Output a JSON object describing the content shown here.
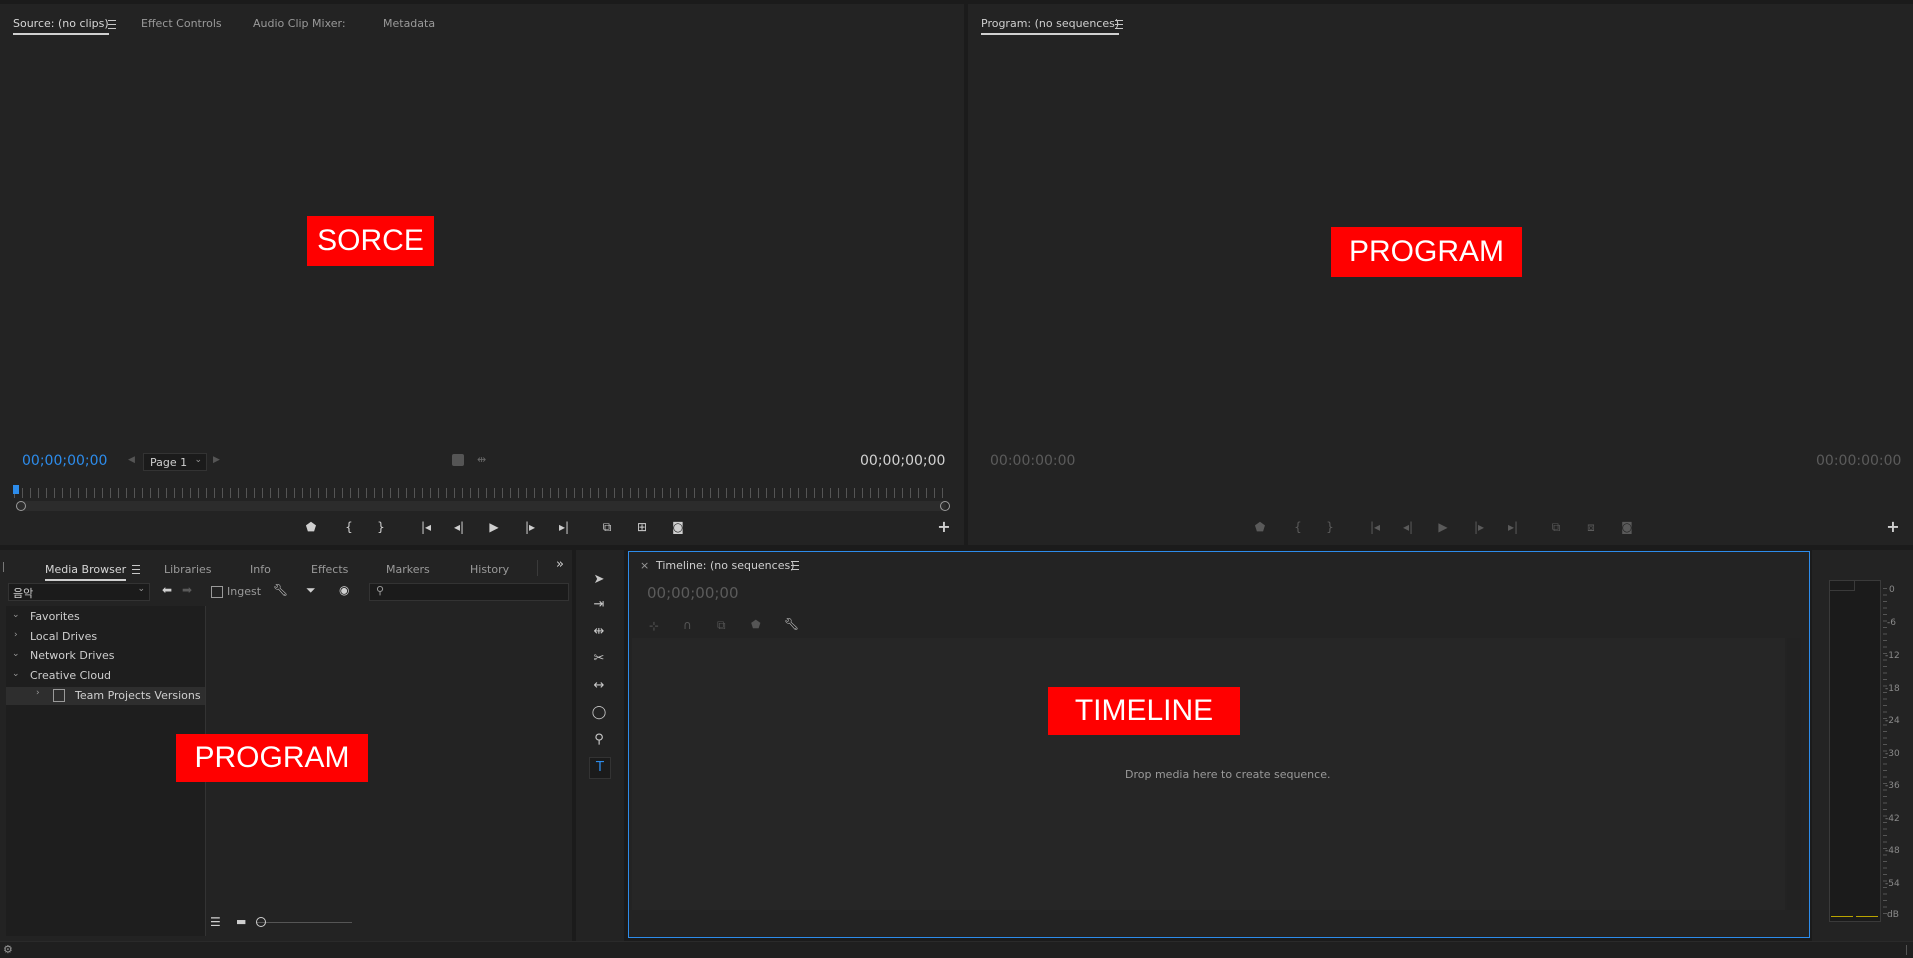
{
  "source": {
    "tabs": [
      "Source: (no clips)",
      "Effect Controls",
      "Audio Clip Mixer:",
      "Metadata"
    ],
    "label": "SORCE",
    "timecode_left": "00;00;00;00",
    "timecode_right": "00;00;00;00",
    "page_select": "Page 1"
  },
  "program": {
    "tab": "Program: (no sequences)",
    "label": "PROGRAM",
    "timecode_left": "00:00:00:00",
    "timecode_right": "00:00:00:00"
  },
  "media_browser": {
    "tabs": [
      "Media Browser",
      "Libraries",
      "Info",
      "Effects",
      "Markers",
      "History"
    ],
    "location": "음악",
    "ingest_label": "Ingest",
    "tree": [
      "Favorites",
      "Local Drives",
      "Network Drives",
      "Creative Cloud",
      "Team Projects Versions"
    ],
    "label": "PROGRAM"
  },
  "timeline": {
    "tab": "Timeline: (no sequences)",
    "close": "×",
    "timecode": "00;00;00;00",
    "drop_text": "Drop media here to create sequence.",
    "label": "TIMELINE"
  },
  "audio_meter": {
    "scale": [
      "0",
      "-6",
      "-12",
      "-18",
      "-24",
      "-30",
      "-36",
      "-42",
      "-48",
      "-54",
      "dB"
    ]
  },
  "colors": {
    "label_bg": "#ff0000",
    "accent_blue": "#2d8ceb",
    "panel_bg": "#232323"
  }
}
